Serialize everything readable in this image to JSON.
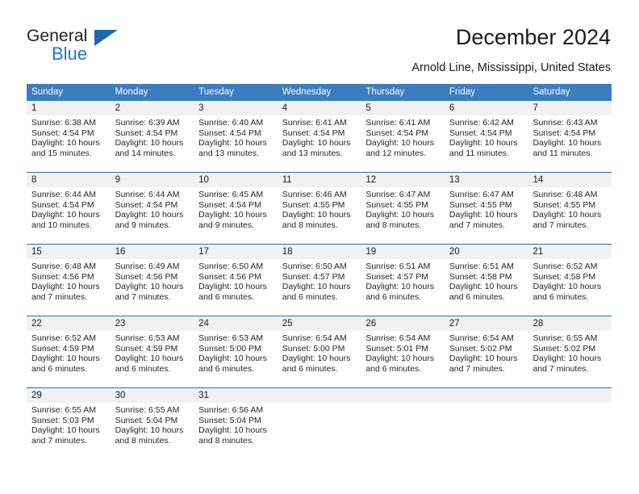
{
  "brand": {
    "name_top": "General",
    "name_bottom": "Blue",
    "accent_color": "#1877c9",
    "triangle_color": "#1b69b1"
  },
  "header": {
    "title": "December 2024",
    "subtitle": "Arnold Line, Mississippi, United States"
  },
  "calendar": {
    "header_bg": "#3b7dbf",
    "daynum_bg": "#f1f1f1",
    "row_border_color": "#2d6fad",
    "weekdays": [
      "Sunday",
      "Monday",
      "Tuesday",
      "Wednesday",
      "Thursday",
      "Friday",
      "Saturday"
    ],
    "weeks": [
      {
        "days": [
          {
            "num": "1",
            "sunrise": "Sunrise: 6:38 AM",
            "sunset": "Sunset: 4:54 PM",
            "daylight1": "Daylight: 10 hours",
            "daylight2": "and 15 minutes."
          },
          {
            "num": "2",
            "sunrise": "Sunrise: 6:39 AM",
            "sunset": "Sunset: 4:54 PM",
            "daylight1": "Daylight: 10 hours",
            "daylight2": "and 14 minutes."
          },
          {
            "num": "3",
            "sunrise": "Sunrise: 6:40 AM",
            "sunset": "Sunset: 4:54 PM",
            "daylight1": "Daylight: 10 hours",
            "daylight2": "and 13 minutes."
          },
          {
            "num": "4",
            "sunrise": "Sunrise: 6:41 AM",
            "sunset": "Sunset: 4:54 PM",
            "daylight1": "Daylight: 10 hours",
            "daylight2": "and 13 minutes."
          },
          {
            "num": "5",
            "sunrise": "Sunrise: 6:41 AM",
            "sunset": "Sunset: 4:54 PM",
            "daylight1": "Daylight: 10 hours",
            "daylight2": "and 12 minutes."
          },
          {
            "num": "6",
            "sunrise": "Sunrise: 6:42 AM",
            "sunset": "Sunset: 4:54 PM",
            "daylight1": "Daylight: 10 hours",
            "daylight2": "and 11 minutes."
          },
          {
            "num": "7",
            "sunrise": "Sunrise: 6:43 AM",
            "sunset": "Sunset: 4:54 PM",
            "daylight1": "Daylight: 10 hours",
            "daylight2": "and 11 minutes."
          }
        ]
      },
      {
        "days": [
          {
            "num": "8",
            "sunrise": "Sunrise: 6:44 AM",
            "sunset": "Sunset: 4:54 PM",
            "daylight1": "Daylight: 10 hours",
            "daylight2": "and 10 minutes."
          },
          {
            "num": "9",
            "sunrise": "Sunrise: 6:44 AM",
            "sunset": "Sunset: 4:54 PM",
            "daylight1": "Daylight: 10 hours",
            "daylight2": "and 9 minutes."
          },
          {
            "num": "10",
            "sunrise": "Sunrise: 6:45 AM",
            "sunset": "Sunset: 4:54 PM",
            "daylight1": "Daylight: 10 hours",
            "daylight2": "and 9 minutes."
          },
          {
            "num": "11",
            "sunrise": "Sunrise: 6:46 AM",
            "sunset": "Sunset: 4:55 PM",
            "daylight1": "Daylight: 10 hours",
            "daylight2": "and 8 minutes."
          },
          {
            "num": "12",
            "sunrise": "Sunrise: 6:47 AM",
            "sunset": "Sunset: 4:55 PM",
            "daylight1": "Daylight: 10 hours",
            "daylight2": "and 8 minutes."
          },
          {
            "num": "13",
            "sunrise": "Sunrise: 6:47 AM",
            "sunset": "Sunset: 4:55 PM",
            "daylight1": "Daylight: 10 hours",
            "daylight2": "and 7 minutes."
          },
          {
            "num": "14",
            "sunrise": "Sunrise: 6:48 AM",
            "sunset": "Sunset: 4:55 PM",
            "daylight1": "Daylight: 10 hours",
            "daylight2": "and 7 minutes."
          }
        ]
      },
      {
        "days": [
          {
            "num": "15",
            "sunrise": "Sunrise: 6:48 AM",
            "sunset": "Sunset: 4:56 PM",
            "daylight1": "Daylight: 10 hours",
            "daylight2": "and 7 minutes."
          },
          {
            "num": "16",
            "sunrise": "Sunrise: 6:49 AM",
            "sunset": "Sunset: 4:56 PM",
            "daylight1": "Daylight: 10 hours",
            "daylight2": "and 7 minutes."
          },
          {
            "num": "17",
            "sunrise": "Sunrise: 6:50 AM",
            "sunset": "Sunset: 4:56 PM",
            "daylight1": "Daylight: 10 hours",
            "daylight2": "and 6 minutes."
          },
          {
            "num": "18",
            "sunrise": "Sunrise: 6:50 AM",
            "sunset": "Sunset: 4:57 PM",
            "daylight1": "Daylight: 10 hours",
            "daylight2": "and 6 minutes."
          },
          {
            "num": "19",
            "sunrise": "Sunrise: 6:51 AM",
            "sunset": "Sunset: 4:57 PM",
            "daylight1": "Daylight: 10 hours",
            "daylight2": "and 6 minutes."
          },
          {
            "num": "20",
            "sunrise": "Sunrise: 6:51 AM",
            "sunset": "Sunset: 4:58 PM",
            "daylight1": "Daylight: 10 hours",
            "daylight2": "and 6 minutes."
          },
          {
            "num": "21",
            "sunrise": "Sunrise: 6:52 AM",
            "sunset": "Sunset: 4:58 PM",
            "daylight1": "Daylight: 10 hours",
            "daylight2": "and 6 minutes."
          }
        ]
      },
      {
        "days": [
          {
            "num": "22",
            "sunrise": "Sunrise: 6:52 AM",
            "sunset": "Sunset: 4:59 PM",
            "daylight1": "Daylight: 10 hours",
            "daylight2": "and 6 minutes."
          },
          {
            "num": "23",
            "sunrise": "Sunrise: 6:53 AM",
            "sunset": "Sunset: 4:59 PM",
            "daylight1": "Daylight: 10 hours",
            "daylight2": "and 6 minutes."
          },
          {
            "num": "24",
            "sunrise": "Sunrise: 6:53 AM",
            "sunset": "Sunset: 5:00 PM",
            "daylight1": "Daylight: 10 hours",
            "daylight2": "and 6 minutes."
          },
          {
            "num": "25",
            "sunrise": "Sunrise: 6:54 AM",
            "sunset": "Sunset: 5:00 PM",
            "daylight1": "Daylight: 10 hours",
            "daylight2": "and 6 minutes."
          },
          {
            "num": "26",
            "sunrise": "Sunrise: 6:54 AM",
            "sunset": "Sunset: 5:01 PM",
            "daylight1": "Daylight: 10 hours",
            "daylight2": "and 6 minutes."
          },
          {
            "num": "27",
            "sunrise": "Sunrise: 6:54 AM",
            "sunset": "Sunset: 5:02 PM",
            "daylight1": "Daylight: 10 hours",
            "daylight2": "and 7 minutes."
          },
          {
            "num": "28",
            "sunrise": "Sunrise: 6:55 AM",
            "sunset": "Sunset: 5:02 PM",
            "daylight1": "Daylight: 10 hours",
            "daylight2": "and 7 minutes."
          }
        ]
      },
      {
        "days": [
          {
            "num": "29",
            "sunrise": "Sunrise: 6:55 AM",
            "sunset": "Sunset: 5:03 PM",
            "daylight1": "Daylight: 10 hours",
            "daylight2": "and 7 minutes."
          },
          {
            "num": "30",
            "sunrise": "Sunrise: 6:55 AM",
            "sunset": "Sunset: 5:04 PM",
            "daylight1": "Daylight: 10 hours",
            "daylight2": "and 8 minutes."
          },
          {
            "num": "31",
            "sunrise": "Sunrise: 6:56 AM",
            "sunset": "Sunset: 5:04 PM",
            "daylight1": "Daylight: 10 hours",
            "daylight2": "and 8 minutes."
          },
          {
            "num": "",
            "sunrise": "",
            "sunset": "",
            "daylight1": "",
            "daylight2": ""
          },
          {
            "num": "",
            "sunrise": "",
            "sunset": "",
            "daylight1": "",
            "daylight2": ""
          },
          {
            "num": "",
            "sunrise": "",
            "sunset": "",
            "daylight1": "",
            "daylight2": ""
          },
          {
            "num": "",
            "sunrise": "",
            "sunset": "",
            "daylight1": "",
            "daylight2": ""
          }
        ]
      }
    ]
  }
}
